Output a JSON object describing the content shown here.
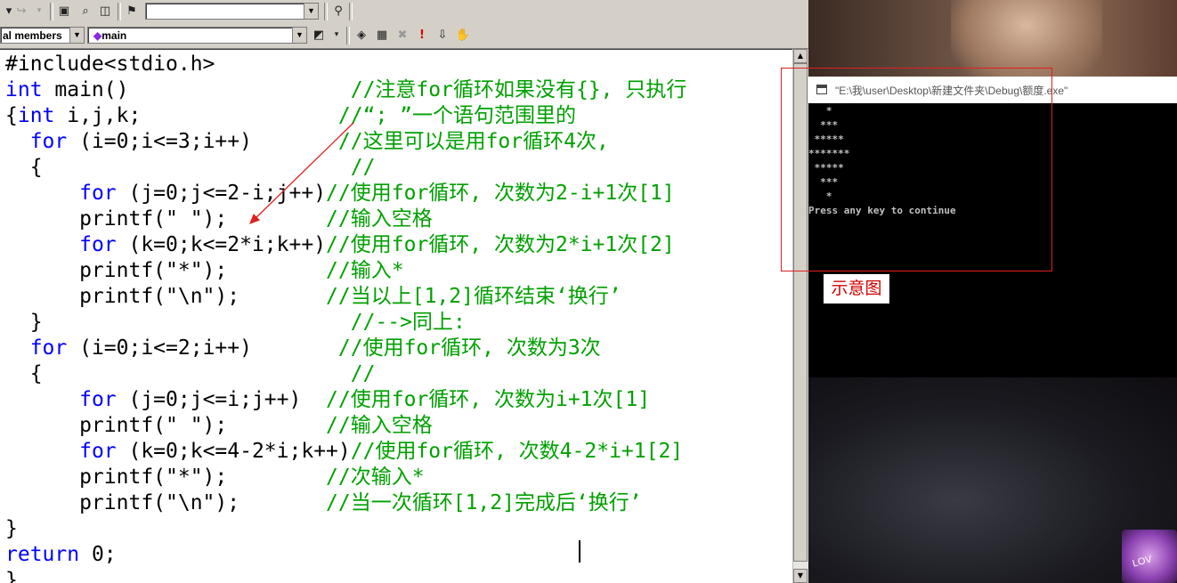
{
  "toolbar2": {
    "scope_combo": "al members",
    "function_combo": "main"
  },
  "code_lines": [
    [
      {
        "t": "#include<stdio.h>",
        "c": "pp"
      }
    ],
    [
      {
        "t": "int",
        "c": "kw"
      },
      {
        "t": " main()                  ",
        "c": ""
      },
      {
        "t": "//注意for循环如果没有{}, 只执行",
        "c": "cm"
      }
    ],
    [
      {
        "t": "{",
        "c": ""
      },
      {
        "t": "int",
        "c": "kw"
      },
      {
        "t": " i,j,k;                ",
        "c": ""
      },
      {
        "t": "//“; ”一个语句范围里的",
        "c": "cm"
      }
    ],
    [
      {
        "t": "  ",
        "c": ""
      },
      {
        "t": "for",
        "c": "kw"
      },
      {
        "t": " (i=0;i<=3;i++)       ",
        "c": ""
      },
      {
        "t": "//这里可以是用for循环4次,",
        "c": "cm"
      }
    ],
    [
      {
        "t": "  {                         ",
        "c": ""
      },
      {
        "t": "//",
        "c": "cm"
      }
    ],
    [
      {
        "t": "      ",
        "c": ""
      },
      {
        "t": "for",
        "c": "kw"
      },
      {
        "t": " (j=0;j<=2-i;j++)",
        "c": ""
      },
      {
        "t": "//使用for循环, 次数为2-i+1次[1]",
        "c": "cm"
      }
    ],
    [
      {
        "t": "      printf(\" \");        ",
        "c": ""
      },
      {
        "t": "//输入空格",
        "c": "cm"
      }
    ],
    [
      {
        "t": "      ",
        "c": ""
      },
      {
        "t": "for",
        "c": "kw"
      },
      {
        "t": " (k=0;k<=2*i;k++)",
        "c": ""
      },
      {
        "t": "//使用for循环, 次数为2*i+1次[2]",
        "c": "cm"
      }
    ],
    [
      {
        "t": "      printf(\"*\");        ",
        "c": ""
      },
      {
        "t": "//输入*",
        "c": "cm"
      }
    ],
    [
      {
        "t": "      printf(\"\\n\");       ",
        "c": ""
      },
      {
        "t": "//当以上[1,2]循环结束‘换行’",
        "c": "cm"
      }
    ],
    [
      {
        "t": "  }                         ",
        "c": ""
      },
      {
        "t": "//-->同上:",
        "c": "cm"
      }
    ],
    [
      {
        "t": "  ",
        "c": ""
      },
      {
        "t": "for",
        "c": "kw"
      },
      {
        "t": " (i=0;i<=2;i++)       ",
        "c": ""
      },
      {
        "t": "//使用for循环, 次数为3次",
        "c": "cm"
      }
    ],
    [
      {
        "t": "  {                         ",
        "c": ""
      },
      {
        "t": "//",
        "c": "cm"
      }
    ],
    [
      {
        "t": "      ",
        "c": ""
      },
      {
        "t": "for",
        "c": "kw"
      },
      {
        "t": " (j=0;j<=i;j++)  ",
        "c": ""
      },
      {
        "t": "//使用for循环, 次数为i+1次[1]",
        "c": "cm"
      }
    ],
    [
      {
        "t": "      printf(\" \");        ",
        "c": ""
      },
      {
        "t": "//输入空格",
        "c": "cm"
      }
    ],
    [
      {
        "t": "      ",
        "c": ""
      },
      {
        "t": "for",
        "c": "kw"
      },
      {
        "t": " (k=0;k<=4-2*i;k++)",
        "c": ""
      },
      {
        "t": "//使用for循环, 次数4-2*i+1[2]",
        "c": "cm"
      }
    ],
    [
      {
        "t": "      printf(\"*\");        ",
        "c": ""
      },
      {
        "t": "//次输入*",
        "c": "cm"
      }
    ],
    [
      {
        "t": "      printf(\"\\n\");       ",
        "c": ""
      },
      {
        "t": "//当一次循环[1,2]完成后‘换行’",
        "c": "cm"
      }
    ],
    [
      {
        "t": "}",
        "c": ""
      }
    ],
    [
      {
        "t": "return",
        "c": "kw"
      },
      {
        "t": " 0;",
        "c": ""
      }
    ],
    [
      {
        "t": "}",
        "c": ""
      }
    ]
  ],
  "console": {
    "title": "\"E:\\我\\user\\Desktop\\新建文件夹\\Debug\\额度.exe\"",
    "lines": [
      "   *",
      "  ***",
      " *****",
      "*******",
      " *****",
      "  ***",
      "   *",
      "Press any key to continue"
    ]
  },
  "caption": "示意图",
  "sticker_text": "LOV"
}
